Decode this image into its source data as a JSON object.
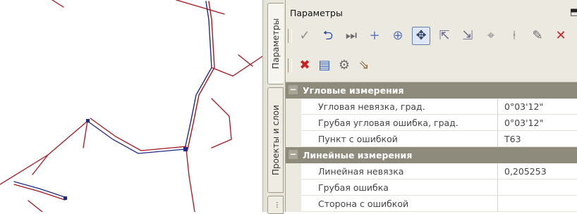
{
  "panel": {
    "title": "Параметры",
    "pin_icon": "⬒"
  },
  "tabs": [
    {
      "label": "Параметры",
      "active": true
    },
    {
      "label": "Проекты и слои",
      "active": false
    },
    {
      "label": "...",
      "active": false
    }
  ],
  "toolbar1": {
    "buttons": [
      {
        "name": "apply-icon",
        "glyph": "✓",
        "color": "#8e8e8e"
      },
      {
        "name": "undo-arrow-icon",
        "glyph": "⮌",
        "color": "#2c4da8"
      },
      {
        "name": "next-point-icon",
        "glyph": "⏭",
        "color": "#6b6b6b"
      },
      {
        "name": "add-point-icon",
        "glyph": "+",
        "color": "#5a79b8"
      },
      {
        "name": "target-icon",
        "glyph": "⊕",
        "color": "#5a79b8"
      },
      {
        "name": "snap-target-icon",
        "glyph": "✥",
        "color": "#2f3f66",
        "pressed": true
      },
      {
        "name": "select-object-icon",
        "glyph": "⇱",
        "color": "#6a6a8a"
      },
      {
        "name": "select-tool-icon",
        "glyph": "⇲",
        "color": "#6a6a8a"
      },
      {
        "name": "measure-icon",
        "glyph": "⌖",
        "color": "#8a8a8a"
      },
      {
        "name": "add-node-icon",
        "glyph": "⍿",
        "color": "#8a8a8a"
      },
      {
        "name": "pencil-icon",
        "glyph": "✎",
        "color": "#6a6a6a"
      },
      {
        "name": "close-x-icon",
        "glyph": "✕",
        "color": "#cc2222"
      }
    ]
  },
  "toolbar2": {
    "buttons": [
      {
        "name": "delete-icon",
        "glyph": "✖",
        "color": "#cc1f1f"
      },
      {
        "name": "document-icon",
        "glyph": "▤",
        "color": "#2f61c2"
      },
      {
        "name": "settings-icon",
        "glyph": "⚙",
        "color": "#6b6b6b"
      },
      {
        "name": "calculate-icon",
        "glyph": "⇘",
        "color": "#8a6a3a"
      }
    ]
  },
  "grid": {
    "rows": [
      {
        "type": "category",
        "toggle": "−",
        "label": "Угловые измерения"
      },
      {
        "type": "property",
        "name": "Угловая невязка, град.",
        "value": "0°03'12\""
      },
      {
        "type": "property",
        "name": "Грубая угловая ошибка, град.",
        "value": "0°03'12\""
      },
      {
        "type": "property",
        "name": "Пункт с ошибкой",
        "value": "T63"
      },
      {
        "type": "category",
        "toggle": "−",
        "label": "Линейные измерения"
      },
      {
        "type": "property",
        "name": "Линейная невязка",
        "value": "0,205253"
      },
      {
        "type": "property",
        "name": "Грубая ошибка",
        "value": ""
      },
      {
        "type": "property",
        "name": "Сторона с ошибкой",
        "value": ""
      }
    ]
  },
  "colors": {
    "survey_line": "#a8141f",
    "selected_line": "#1f2a8a",
    "category_bg": "#8e8a7c"
  }
}
